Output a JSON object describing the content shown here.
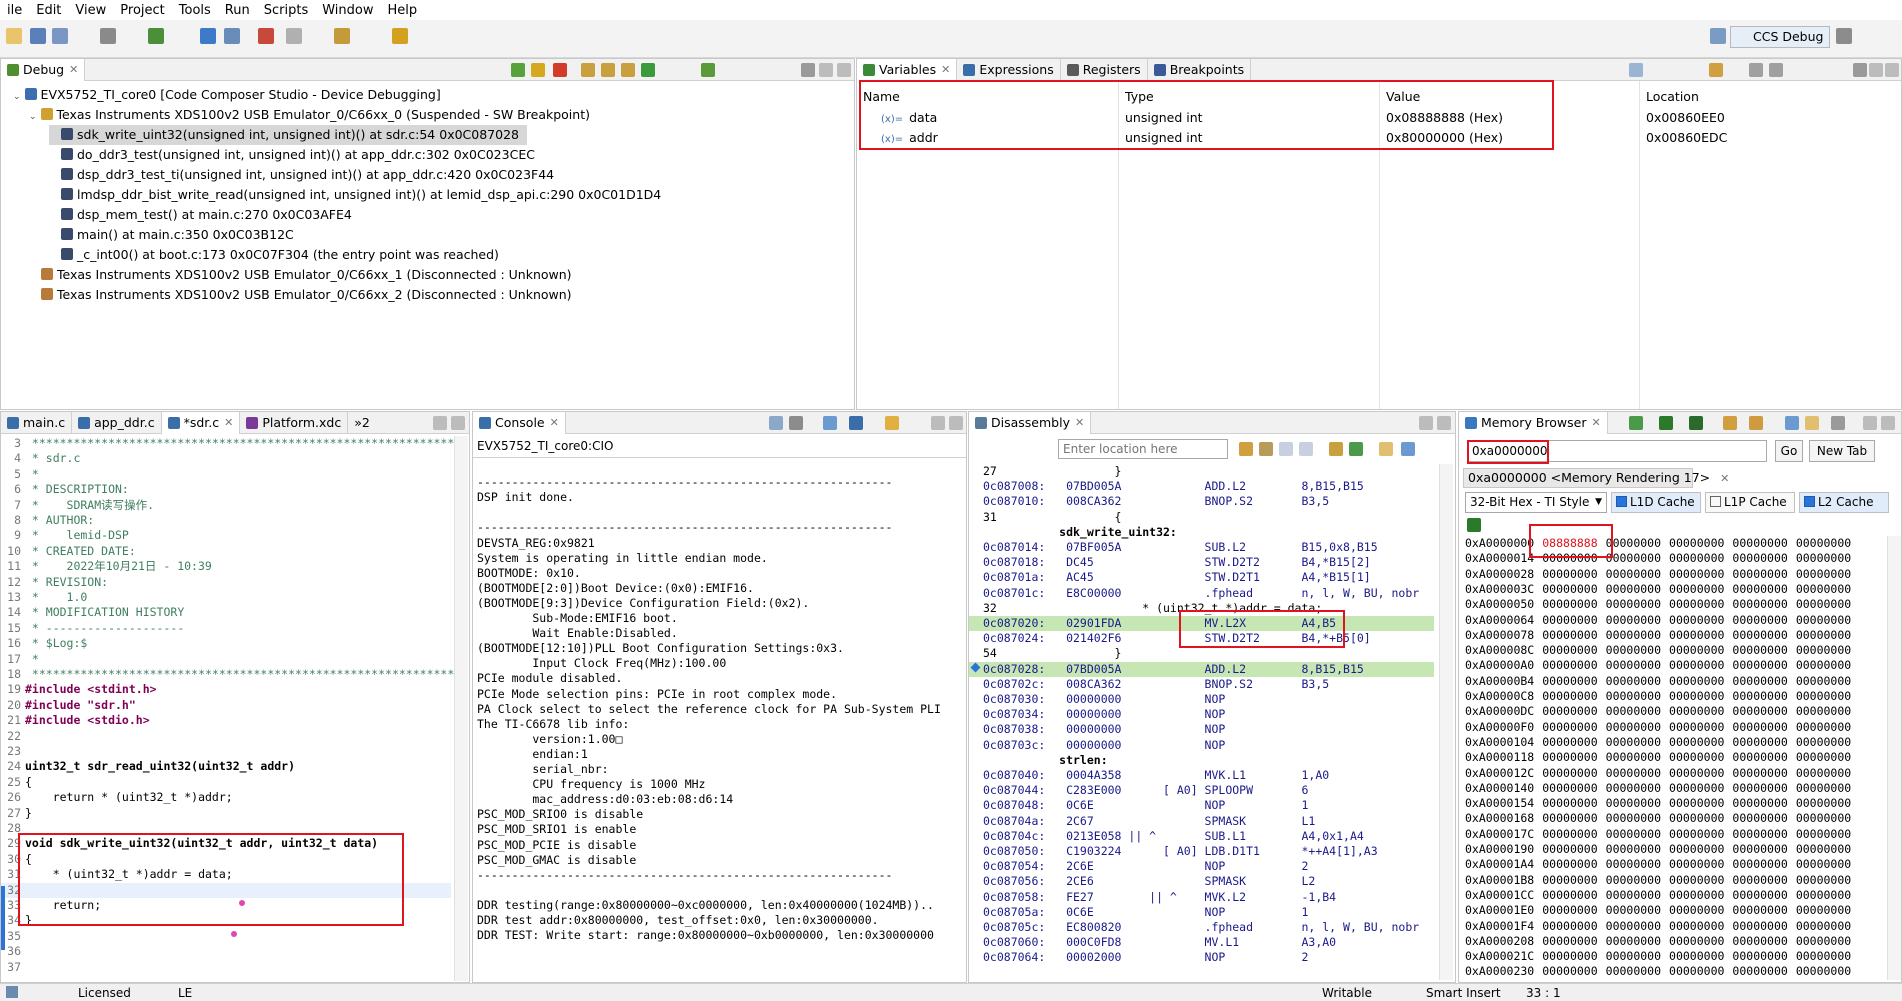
{
  "menu": [
    "ile",
    "Edit",
    "View",
    "Project",
    "Tools",
    "Run",
    "Scripts",
    "Window",
    "Help"
  ],
  "perspective": "CCS Debug",
  "debug": {
    "tab": "Debug",
    "rows": [
      "EVX5752_TI_core0 [Code Composer Studio - Device Debugging]",
      "Texas Instruments XDS100v2 USB Emulator_0/C66xx_0 (Suspended - SW Breakpoint)",
      "sdk_write_uint32(unsigned int, unsigned int)() at sdr.c:54 0x0C087028",
      "do_ddr3_test(unsigned int, unsigned int)() at app_ddr.c:302 0x0C023CEC",
      "dsp_ddr3_test_ti(unsigned int, unsigned int)() at app_ddr.c:420 0x0C023F44",
      "lmdsp_ddr_bist_write_read(unsigned int, unsigned int)() at lemid_dsp_api.c:290 0x0C01D1D4",
      "dsp_mem_test() at main.c:270 0x0C03AFE4",
      "main() at main.c:350 0x0C03B12C",
      "_c_int00() at boot.c:173 0x0C07F304  (the entry point was reached)",
      "Texas Instruments XDS100v2 USB Emulator_0/C66xx_1 (Disconnected : Unknown)",
      "Texas Instruments XDS100v2 USB Emulator_0/C66xx_2 (Disconnected : Unknown)"
    ]
  },
  "variables": {
    "tabs": [
      "Variables",
      "Expressions",
      "Registers",
      "Breakpoints"
    ],
    "columns": [
      "Name",
      "Type",
      "Value",
      "Location"
    ],
    "rows": [
      {
        "name": "data",
        "type": "unsigned int",
        "value": "0x08888888 (Hex)",
        "location": "0x00860EE0"
      },
      {
        "name": "addr",
        "type": "unsigned int",
        "value": "0x80000000 (Hex)",
        "location": "0x00860EDC"
      }
    ]
  },
  "editor": {
    "tabs": [
      "main.c",
      "app_ddr.c",
      "*sdr.c",
      "Platform.xdc",
      "»2"
    ],
    "lines": [
      {
        "n": "3",
        "t": " *********************************************************************",
        "c": "cmt"
      },
      {
        "n": "4",
        "t": " * sdr.c",
        "c": "cmt"
      },
      {
        "n": "5",
        "t": " *",
        "c": "cmt"
      },
      {
        "n": "6",
        "t": " * DESCRIPTION:",
        "c": "cmt"
      },
      {
        "n": "7",
        "t": " *    SDRAM读写操作.",
        "c": "cmt"
      },
      {
        "n": "8",
        "t": " * AUTHOR:",
        "c": "cmt"
      },
      {
        "n": "9",
        "t": " *    lemid-DSP",
        "c": "cmt"
      },
      {
        "n": "10",
        "t": " * CREATED DATE:",
        "c": "cmt"
      },
      {
        "n": "11",
        "t": " *    2022年10月21日 - 10:39",
        "c": "cmt"
      },
      {
        "n": "12",
        "t": " * REVISION:",
        "c": "cmt"
      },
      {
        "n": "13",
        "t": " *    1.0",
        "c": "cmt"
      },
      {
        "n": "14",
        "t": " * MODIFICATION HISTORY",
        "c": "cmt"
      },
      {
        "n": "15",
        "t": " * --------------------",
        "c": "cmt"
      },
      {
        "n": "16",
        "t": " * $Log:$",
        "c": "cmt"
      },
      {
        "n": "17",
        "t": " *",
        "c": "cmt"
      },
      {
        "n": "18",
        "t": " *********************************************************************/",
        "c": "cmt"
      },
      {
        "n": "19",
        "t": "#include <stdint.h>",
        "c": "inc"
      },
      {
        "n": "20",
        "t": "#include \"sdr.h\"",
        "c": "inc"
      },
      {
        "n": "21",
        "t": "#include <stdio.h>",
        "c": "inc"
      },
      {
        "n": "22",
        "t": "",
        "c": ""
      },
      {
        "n": "23",
        "t": "",
        "c": ""
      },
      {
        "n": "24",
        "t": "uint32_t sdr_read_uint32(uint32_t addr)",
        "c": "fn"
      },
      {
        "n": "25",
        "t": "{",
        "c": ""
      },
      {
        "n": "26",
        "t": "    return * (uint32_t *)addr;",
        "c": "ret"
      },
      {
        "n": "27",
        "t": "}",
        "c": ""
      },
      {
        "n": "28",
        "t": "",
        "c": ""
      },
      {
        "n": "29",
        "t": "void sdk_write_uint32(uint32_t addr, uint32_t data)",
        "c": "fn2"
      },
      {
        "n": "30",
        "t": "{",
        "c": ""
      },
      {
        "n": "31",
        "t": "    * (uint32_t *)addr = data;",
        "c": ""
      },
      {
        "n": "32",
        "t": "",
        "c": ""
      },
      {
        "n": "33",
        "t": "    return;",
        "c": "ret"
      },
      {
        "n": "34",
        "t": "}",
        "c": ""
      },
      {
        "n": "35",
        "t": "",
        "c": ""
      },
      {
        "n": "36",
        "t": "",
        "c": ""
      },
      {
        "n": "37",
        "t": "",
        "c": ""
      }
    ]
  },
  "console": {
    "tab": "Console",
    "title": "EVX5752_TI_core0:CIO",
    "lines": [
      "",
      "------------------------------------------------------------",
      "DSP init done.",
      "",
      "------------------------------------------------------------",
      "DEVSTA_REG:0x9821",
      "System is operating in little endian mode.",
      "BOOTMODE: 0x10.",
      "(BOOTMODE[2:0])Boot Device:(0x0):EMIF16.",
      "(BOOTMODE[9:3])Device Configuration Field:(0x2).",
      "        Sub-Mode:EMIF16 boot.",
      "        Wait Enable:Disabled.",
      "(BOOTMODE[12:10])PLL Boot Configuration Settings:0x3.",
      "        Input Clock Freq(MHz):100.00",
      "PCIe module disabled.",
      "PCIe Mode selection pins: PCIe in root complex mode.",
      "PA Clock select to select the reference clock for PA Sub-System PLI",
      "The TI-C6678 lib info:",
      "        version:1.00□",
      "        endian:1",
      "        serial_nbr:",
      "        CPU frequency is 1000 MHz",
      "        mac_address:d0:03:eb:08:d6:14",
      "PSC_MOD_SRIO0 is disable",
      "PSC_MOD_SRIO1 is enable",
      "PSC_MOD_PCIE is disable",
      "PSC_MOD_GMAC is disable",
      "------------------------------------------------------------",
      "",
      "DDR testing(range:0x80000000~0xc0000000, len:0x40000000(1024MB))..",
      "DDR test addr:0x80000000, test_offset:0x0, len:0x30000000.",
      "DDR TEST: Write start: range:0x80000000~0xb0000000, len:0x30000000"
    ]
  },
  "disassembly": {
    "tab": "Disassembly",
    "location_placeholder": "Enter location here",
    "lines": [
      {
        "t": "27                 }",
        "c": "src"
      },
      {
        "t": "0c087008:   07BD005A            ADD.L2        8,B15,B15",
        "c": ""
      },
      {
        "t": "0c087010:   008CA362            BNOP.S2       B3,5",
        "c": ""
      },
      {
        "t": "31                 {",
        "c": "src"
      },
      {
        "t": "           sdk_write_uint32:",
        "c": "lbl"
      },
      {
        "t": "0c087014:   07BF005A            SUB.L2        B15,0x8,B15",
        "c": ""
      },
      {
        "t": "0c087018:   DC45                STW.D2T2      B4,*B15[2]",
        "c": ""
      },
      {
        "t": "0c08701a:   AC45                STW.D2T1      A4,*B15[1]",
        "c": ""
      },
      {
        "t": "0c08701c:   E8C00000            .fphead       n, l, W, BU, nobr",
        "c": ""
      },
      {
        "t": "32                     * (uint32_t *)addr = data;",
        "c": "src"
      },
      {
        "t": "0c087020:   02901FDA            MV.L2X        A4,B5",
        "c": "hl"
      },
      {
        "t": "0c087024:   021402F6            STW.D2T2      B4,*+B5[0]",
        "c": ""
      },
      {
        "t": "54                 }",
        "c": "src"
      },
      {
        "t": "0c087028:   07BD005A            ADD.L2        8,B15,B15",
        "c": "cur"
      },
      {
        "t": "0c08702c:   008CA362            BNOP.S2       B3,5",
        "c": ""
      },
      {
        "t": "0c087030:   00000000            NOP",
        "c": ""
      },
      {
        "t": "0c087034:   00000000            NOP",
        "c": ""
      },
      {
        "t": "0c087038:   00000000            NOP",
        "c": ""
      },
      {
        "t": "0c08703c:   00000000            NOP",
        "c": ""
      },
      {
        "t": "           strlen:",
        "c": "lbl"
      },
      {
        "t": "0c087040:   0004A358            MVK.L1        1,A0",
        "c": ""
      },
      {
        "t": "0c087044:   C283E000      [ A0] SPLOOPW       6",
        "c": ""
      },
      {
        "t": "0c087048:   0C6E                NOP           1",
        "c": ""
      },
      {
        "t": "0c08704a:   2C67                SPMASK        L1",
        "c": ""
      },
      {
        "t": "0c08704c:   0213E058 || ^       SUB.L1        A4,0x1,A4",
        "c": ""
      },
      {
        "t": "0c087050:   C1903224      [ A0] LDB.D1T1      *++A4[1],A3",
        "c": ""
      },
      {
        "t": "0c087054:   2C6E                NOP           2",
        "c": ""
      },
      {
        "t": "0c087056:   2CE6                SPMASK        L2",
        "c": ""
      },
      {
        "t": "0c087058:   FE27        || ^    MVK.L2        -1,B4",
        "c": ""
      },
      {
        "t": "0c08705a:   0C6E                NOP           1",
        "c": ""
      },
      {
        "t": "0c08705c:   EC800820            .fphead       n, l, W, BU, nobr",
        "c": ""
      },
      {
        "t": "0c087060:   000C0FD8            MV.L1         A3,A0",
        "c": ""
      },
      {
        "t": "0c087064:   00002000            NOP           2",
        "c": ""
      }
    ]
  },
  "memory": {
    "tab": "Memory Browser",
    "address_input": "0xa0000000",
    "go_label": "Go",
    "new_tab_label": "New Tab",
    "rendering_tab": "0xa0000000 <Memory Rendering 17>",
    "format": "32-Bit Hex - TI Style",
    "cache": [
      "L1D Cache",
      "L1P Cache",
      "L2 Cache"
    ],
    "cache_checked": [
      true,
      false,
      true
    ],
    "rows": [
      [
        "0xA0000000",
        "08888888",
        "00000000",
        "00000000",
        "00000000",
        "00000000"
      ],
      [
        "0xA0000014",
        "00000000",
        "00000000",
        "00000000",
        "00000000",
        "00000000"
      ],
      [
        "0xA0000028",
        "00000000",
        "00000000",
        "00000000",
        "00000000",
        "00000000"
      ],
      [
        "0xA000003C",
        "00000000",
        "00000000",
        "00000000",
        "00000000",
        "00000000"
      ],
      [
        "0xA0000050",
        "00000000",
        "00000000",
        "00000000",
        "00000000",
        "00000000"
      ],
      [
        "0xA0000064",
        "00000000",
        "00000000",
        "00000000",
        "00000000",
        "00000000"
      ],
      [
        "0xA0000078",
        "00000000",
        "00000000",
        "00000000",
        "00000000",
        "00000000"
      ],
      [
        "0xA000008C",
        "00000000",
        "00000000",
        "00000000",
        "00000000",
        "00000000"
      ],
      [
        "0xA00000A0",
        "00000000",
        "00000000",
        "00000000",
        "00000000",
        "00000000"
      ],
      [
        "0xA00000B4",
        "00000000",
        "00000000",
        "00000000",
        "00000000",
        "00000000"
      ],
      [
        "0xA00000C8",
        "00000000",
        "00000000",
        "00000000",
        "00000000",
        "00000000"
      ],
      [
        "0xA00000DC",
        "00000000",
        "00000000",
        "00000000",
        "00000000",
        "00000000"
      ],
      [
        "0xA00000F0",
        "00000000",
        "00000000",
        "00000000",
        "00000000",
        "00000000"
      ],
      [
        "0xA0000104",
        "00000000",
        "00000000",
        "00000000",
        "00000000",
        "00000000"
      ],
      [
        "0xA0000118",
        "00000000",
        "00000000",
        "00000000",
        "00000000",
        "00000000"
      ],
      [
        "0xA000012C",
        "00000000",
        "00000000",
        "00000000",
        "00000000",
        "00000000"
      ],
      [
        "0xA0000140",
        "00000000",
        "00000000",
        "00000000",
        "00000000",
        "00000000"
      ],
      [
        "0xA0000154",
        "00000000",
        "00000000",
        "00000000",
        "00000000",
        "00000000"
      ],
      [
        "0xA0000168",
        "00000000",
        "00000000",
        "00000000",
        "00000000",
        "00000000"
      ],
      [
        "0xA000017C",
        "00000000",
        "00000000",
        "00000000",
        "00000000",
        "00000000"
      ],
      [
        "0xA0000190",
        "00000000",
        "00000000",
        "00000000",
        "00000000",
        "00000000"
      ],
      [
        "0xA00001A4",
        "00000000",
        "00000000",
        "00000000",
        "00000000",
        "00000000"
      ],
      [
        "0xA00001B8",
        "00000000",
        "00000000",
        "00000000",
        "00000000",
        "00000000"
      ],
      [
        "0xA00001CC",
        "00000000",
        "00000000",
        "00000000",
        "00000000",
        "00000000"
      ],
      [
        "0xA00001E0",
        "00000000",
        "00000000",
        "00000000",
        "00000000",
        "00000000"
      ],
      [
        "0xA00001F4",
        "00000000",
        "00000000",
        "00000000",
        "00000000",
        "00000000"
      ],
      [
        "0xA0000208",
        "00000000",
        "00000000",
        "00000000",
        "00000000",
        "00000000"
      ],
      [
        "0xA000021C",
        "00000000",
        "00000000",
        "00000000",
        "00000000",
        "00000000"
      ],
      [
        "0xA0000230",
        "00000000",
        "00000000",
        "00000000",
        "00000000",
        "00000000"
      ]
    ]
  },
  "status": {
    "license": "Licensed",
    "le": "LE",
    "writable": "Writable",
    "insert": "Smart Insert",
    "position": "33 : 1"
  },
  "colors": {
    "highlight_box": "#e0141e",
    "current_line": "#c6e7b4",
    "selection": "#d7d7d7"
  }
}
